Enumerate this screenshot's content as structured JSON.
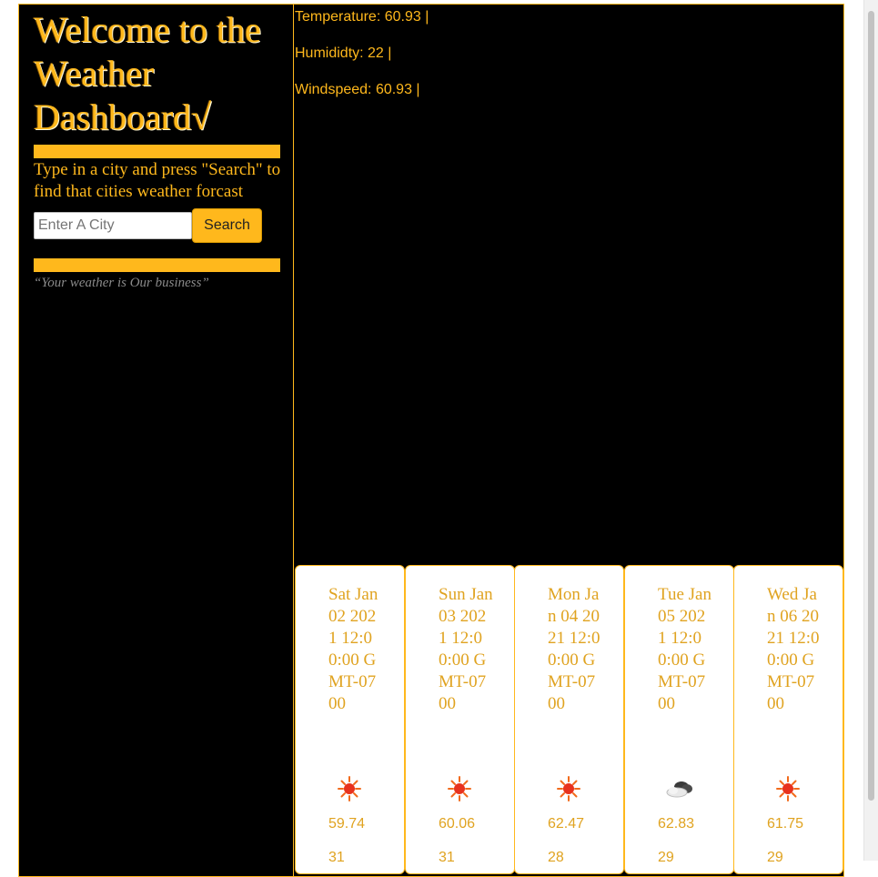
{
  "header": {
    "title": "Welcome to the Weather Dashboard√",
    "instructions": "Type in a city and press \"Search\" to find that cities weather forcast",
    "tagline": "“Your weather is Our business”"
  },
  "search": {
    "placeholder": "Enter A City",
    "value": "",
    "button_label": "Search"
  },
  "current": {
    "temperature": "Temperature: 60.93 |",
    "humidity": "Humididty: 22 |",
    "windspeed": "Windspeed: 60.93 |"
  },
  "forecast": [
    {
      "date": "Sat Jan 02 2021 12:00:00 GMT-0700",
      "icon": "sun-icon",
      "temp": "59.74",
      "humidity": "31"
    },
    {
      "date": "Sun Jan 03 2021 12:00:00 GMT-0700",
      "icon": "sun-icon",
      "temp": "60.06",
      "humidity": "31"
    },
    {
      "date": "Mon Jan 04 2021 12:00:00 GMT-0700",
      "icon": "sun-icon",
      "temp": "62.47",
      "humidity": "28"
    },
    {
      "date": "Tue Jan 05 2021 12:00:00 GMT-0700",
      "icon": "cloud-icon",
      "temp": "62.83",
      "humidity": "29"
    },
    {
      "date": "Wed Jan 06 2021 12:00:00 GMT-0700",
      "icon": "sun-icon",
      "temp": "61.75",
      "humidity": "29"
    }
  ],
  "colors": {
    "accent": "#ffb81c",
    "background": "#000000",
    "card_background": "#ffffff",
    "tagline": "#8a8a8a"
  }
}
